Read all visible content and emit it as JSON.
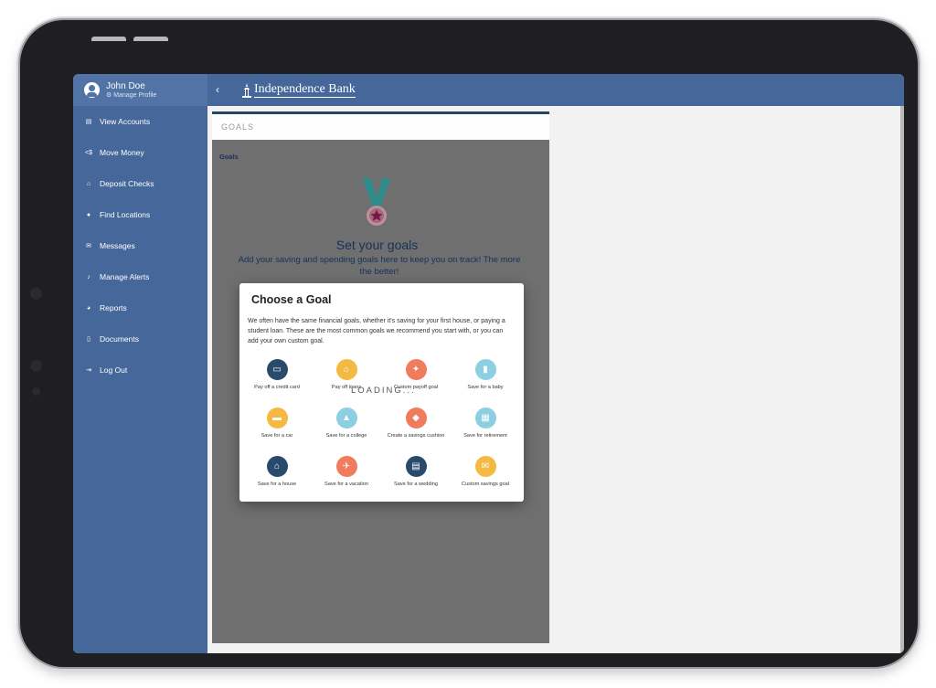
{
  "profile": {
    "name": "John Doe",
    "manage_label": "Manage Profile"
  },
  "sidebar": {
    "items": [
      {
        "label": "View Accounts",
        "icon": "accounts-icon",
        "glyph": "▤"
      },
      {
        "label": "Move Money",
        "icon": "transfer-icon",
        "glyph": "<$"
      },
      {
        "label": "Deposit Checks",
        "icon": "bank-icon",
        "glyph": "⌂"
      },
      {
        "label": "Find Locations",
        "icon": "location-pin-icon",
        "glyph": "●"
      },
      {
        "label": "Messages",
        "icon": "envelope-icon",
        "glyph": "✉"
      },
      {
        "label": "Manage Alerts",
        "icon": "bell-icon",
        "glyph": "♪"
      },
      {
        "label": "Reports",
        "icon": "chart-icon",
        "glyph": "◕"
      },
      {
        "label": "Documents",
        "icon": "document-icon",
        "glyph": "▯"
      },
      {
        "label": "Log Out",
        "icon": "logout-icon",
        "glyph": "⇥"
      }
    ]
  },
  "header": {
    "back_glyph": "‹",
    "brand": "Independence Bank"
  },
  "panel": {
    "heading": "GOALS",
    "breadcrumb": "Goals",
    "hero_title": "Set your goals",
    "hero_desc": "Add your saving and spending goals here to keep you on track! The more the better!"
  },
  "modal": {
    "title": "Choose a Goal",
    "description": "We often have the same financial goals, whether it's saving for your first house, or paying a student loan. These are the most common goals we recommend you start with, or you can add your own custom goal.",
    "loading": "LOADING...",
    "goals": [
      {
        "label": "Pay off a credit card",
        "icon": "credit-card-icon",
        "color": "#2a4a6b",
        "glyph": "▭"
      },
      {
        "label": "Pay off loans",
        "icon": "loan-bank-icon",
        "color": "#f4b942",
        "glyph": "⌂"
      },
      {
        "label": "Custom payoff goal",
        "icon": "lightbulb-icon",
        "color": "#f07b5d",
        "glyph": "✦"
      },
      {
        "label": "Save for a baby",
        "icon": "baby-bottle-icon",
        "color": "#8ccfe0",
        "glyph": "▮"
      },
      {
        "label": "Save for a car",
        "icon": "car-icon",
        "color": "#f4b942",
        "glyph": "▬"
      },
      {
        "label": "Save for a college",
        "icon": "graduation-cap-icon",
        "color": "#8ccfe0",
        "glyph": "▲"
      },
      {
        "label": "Create a savings cushion",
        "icon": "umbrella-icon",
        "color": "#f07b5d",
        "glyph": "◆"
      },
      {
        "label": "Save for retirement",
        "icon": "calendar-icon",
        "color": "#8ccfe0",
        "glyph": "▦"
      },
      {
        "label": "Save for a house",
        "icon": "house-icon",
        "color": "#2a4a6b",
        "glyph": "⌂"
      },
      {
        "label": "Save for a vacation",
        "icon": "airplane-icon",
        "color": "#f07b5d",
        "glyph": "✈"
      },
      {
        "label": "Save for a wedding",
        "icon": "wedding-cake-icon",
        "color": "#2a4a6b",
        "glyph": "▤"
      },
      {
        "label": "Custom savings goal",
        "icon": "envelope-money-icon",
        "color": "#f4b942",
        "glyph": "✉"
      }
    ]
  }
}
